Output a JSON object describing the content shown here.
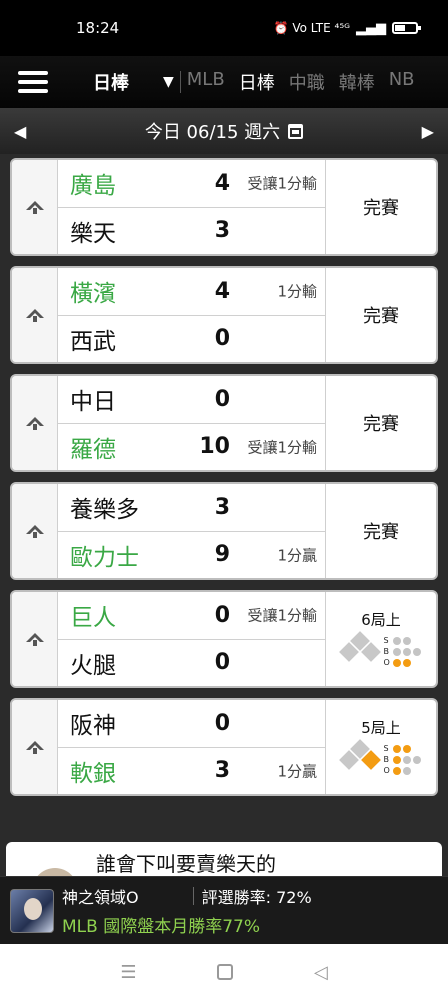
{
  "status_bar": {
    "time": "18:24",
    "indicators": "⏰ Vo LTE ⁴⁵ᴳ"
  },
  "nav": {
    "selected_league": "日棒",
    "caret": "▼",
    "tabs": [
      {
        "label": "MLB",
        "active": false
      },
      {
        "label": "日棒",
        "active": true
      },
      {
        "label": "中職",
        "active": false
      },
      {
        "label": "韓棒",
        "active": false
      },
      {
        "label": "NB",
        "active": false
      }
    ]
  },
  "date_bar": {
    "prev": "◀",
    "label": "今日 06/15 週六",
    "next": "▶"
  },
  "games": [
    {
      "teams": [
        {
          "name": "廣島",
          "score": "4",
          "note": "受讓1分輸",
          "green": true
        },
        {
          "name": "樂天",
          "score": "3",
          "note": "",
          "green": false
        }
      ],
      "status": "完賽"
    },
    {
      "teams": [
        {
          "name": "橫濱",
          "score": "4",
          "note": "1分輸",
          "green": true
        },
        {
          "name": "西武",
          "score": "0",
          "note": "",
          "green": false
        }
      ],
      "status": "完賽"
    },
    {
      "teams": [
        {
          "name": "中日",
          "score": "0",
          "note": "",
          "green": false
        },
        {
          "name": "羅德",
          "score": "10",
          "note": "受讓1分輸",
          "green": true
        }
      ],
      "status": "完賽"
    },
    {
      "teams": [
        {
          "name": "養樂多",
          "score": "3",
          "note": "",
          "green": false
        },
        {
          "name": "歐力士",
          "score": "9",
          "note": "1分贏",
          "green": true
        }
      ],
      "status": "完賽"
    },
    {
      "teams": [
        {
          "name": "巨人",
          "score": "0",
          "note": "受讓1分輸",
          "green": true
        },
        {
          "name": "火腿",
          "score": "0",
          "note": "",
          "green": false
        }
      ],
      "status": "6局上",
      "live": {
        "bases": [
          false,
          false,
          false
        ],
        "strikes": 0,
        "balls": 0,
        "outs": 2
      }
    },
    {
      "teams": [
        {
          "name": "阪神",
          "score": "0",
          "note": "",
          "green": false
        },
        {
          "name": "軟銀",
          "score": "3",
          "note": "1分贏",
          "green": true
        }
      ],
      "status": "5局上",
      "live": {
        "bases": [
          true,
          false,
          false
        ],
        "strikes": 2,
        "balls": 1,
        "outs": 1
      }
    }
  ],
  "sbo_labels": {
    "s": "S",
    "b": "B",
    "o": "O"
  },
  "article": {
    "title": "誰會下叫要賣樂天的"
  },
  "banner": {
    "username": "神之領域O",
    "rate": "評選勝率: 72%",
    "subtitle": "MLB 國際盤本月勝率77%"
  },
  "colors": {
    "green_team": "#3aa845",
    "runner_on": "#f39c12",
    "banner_green": "#8fd14f"
  }
}
